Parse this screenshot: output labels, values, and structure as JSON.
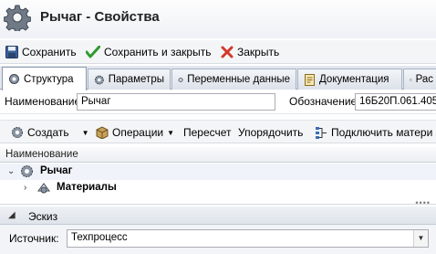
{
  "window": {
    "title": "Рычаг - Свойства",
    "icon": "gear-icon"
  },
  "toolbar": {
    "save": "Сохранить",
    "save_close": "Сохранить и закрыть",
    "close": "Закрыть"
  },
  "tabs": [
    {
      "label": "Структура",
      "icon": "structure-icon",
      "active": true
    },
    {
      "label": "Параметры",
      "icon": "gear-icon"
    },
    {
      "label": "Переменные данные",
      "icon": "gear-icon"
    },
    {
      "label": "Документация",
      "icon": "document-icon"
    },
    {
      "label": "Рас",
      "icon": "document-icon"
    }
  ],
  "fields": {
    "name_label": "Наименование",
    "name_value": "Рычаг",
    "designation_label": "Обозначение",
    "designation_value": "16Б20П.061.405"
  },
  "structure_toolbar": {
    "create": "Создать",
    "operations": "Операции",
    "recalc": "Пересчет",
    "sort": "Упорядочить",
    "connect": "Подключить матери"
  },
  "grid": {
    "header": "Наименование",
    "rows": [
      {
        "label": "Рычаг",
        "expanded": true
      },
      {
        "label": "Материалы",
        "expanded": false
      }
    ]
  },
  "sketch": {
    "title": "Эскиз",
    "source_label": "Источник:",
    "source_value": "Техпроцесс"
  },
  "colors": {
    "save_green": "#2e9b2e",
    "close_red": "#d23a2a",
    "tab_border": "#8c99ad"
  }
}
